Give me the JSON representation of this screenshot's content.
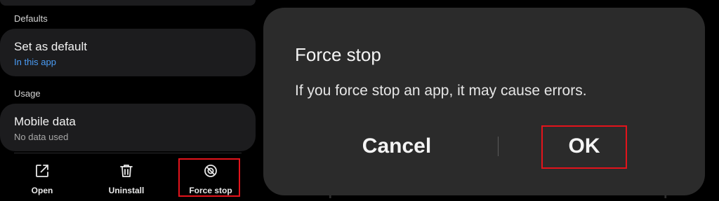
{
  "left": {
    "defaults_label": "Defaults",
    "set_default": {
      "title": "Set as default",
      "subtitle": "In this app"
    },
    "usage_label": "Usage",
    "mobile_data": {
      "title": "Mobile data",
      "subtitle": "No data used"
    },
    "actions": [
      {
        "label": "Open",
        "icon": "open-external-icon"
      },
      {
        "label": "Uninstall",
        "icon": "trash-icon"
      },
      {
        "label": "Force stop",
        "icon": "block-icon"
      }
    ]
  },
  "background_actions": [
    "Open",
    "Uninstall",
    "Force stop"
  ],
  "dialog": {
    "title": "Force stop",
    "message": "If you force stop an app, it may cause errors.",
    "cancel_label": "Cancel",
    "ok_label": "OK"
  },
  "colors": {
    "accent_link": "#4a9cf5",
    "highlight": "#e3131b",
    "dialog_bg": "#2b2b2b",
    "card_bg": "#1c1c1e"
  }
}
